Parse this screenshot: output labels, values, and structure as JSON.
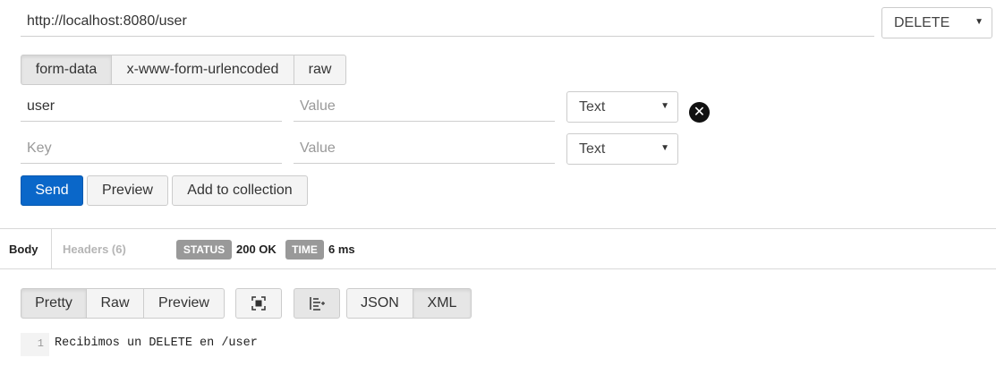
{
  "request": {
    "url": "http://localhost:8080/user",
    "method": "DELETE"
  },
  "body_tabs": [
    {
      "label": "form-data",
      "active": true
    },
    {
      "label": "x-www-form-urlencoded",
      "active": false
    },
    {
      "label": "raw",
      "active": false
    }
  ],
  "params": [
    {
      "key": "user",
      "key_placeholder": "Key",
      "value": "",
      "value_placeholder": "Value",
      "type": "Text"
    },
    {
      "key": "",
      "key_placeholder": "Key",
      "value": "",
      "value_placeholder": "Value",
      "type": "Text"
    }
  ],
  "actions": {
    "send": "Send",
    "preview": "Preview",
    "add_to_collection": "Add to collection"
  },
  "response": {
    "tabs": {
      "body": "Body",
      "headers": "Headers (6)"
    },
    "status_label": "STATUS",
    "status_value": "200 OK",
    "time_label": "TIME",
    "time_value": "6 ms",
    "view_modes": [
      {
        "label": "Pretty",
        "active": true
      },
      {
        "label": "Raw",
        "active": false
      },
      {
        "label": "Preview",
        "active": false
      }
    ],
    "formats": [
      {
        "label": "JSON",
        "active": false
      },
      {
        "label": "XML",
        "active": true
      }
    ],
    "lines": [
      {
        "number": "1",
        "text": "Recibimos un DELETE en /user"
      }
    ]
  },
  "icons": {
    "method_dropdown": "chevron-down-icon",
    "remove_param": "close-circle-icon",
    "fullscreen": "fullscreen-icon",
    "wrap": "wrap-lines-icon"
  },
  "colors": {
    "send_button": "#0a67c9",
    "badge": "#999999"
  }
}
